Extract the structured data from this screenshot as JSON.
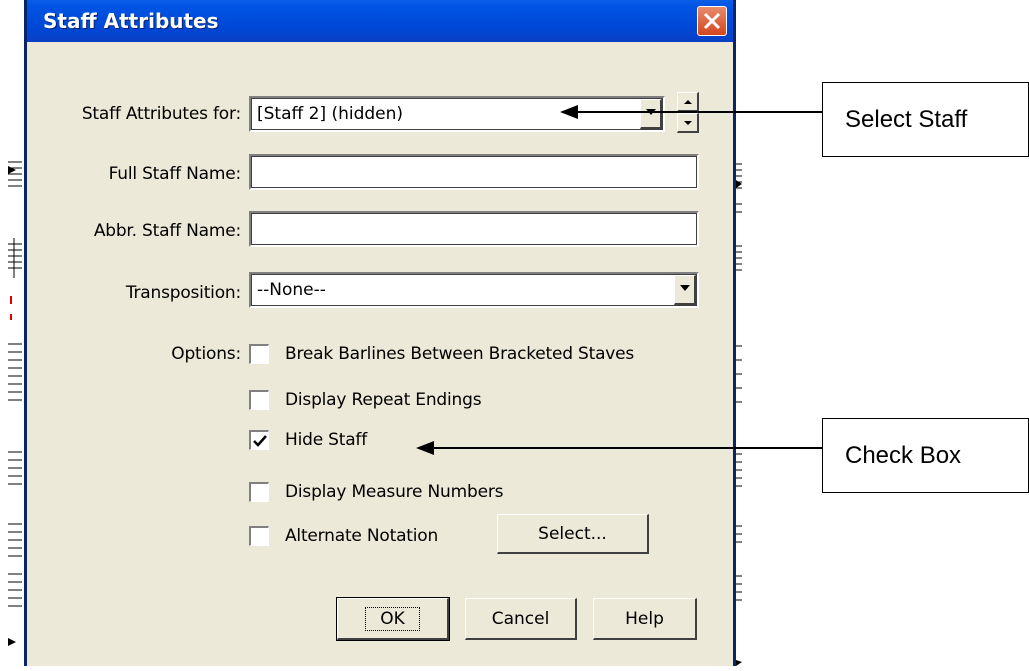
{
  "dialog": {
    "title": "Staff Attributes",
    "staff_for_label": "Staff Attributes for:",
    "staff_for_value": "[Staff 2] (hidden)",
    "full_name_label": "Full Staff Name:",
    "full_name_value": "",
    "abbr_name_label": "Abbr. Staff Name:",
    "abbr_name_value": "",
    "transposition_label": "Transposition:",
    "transposition_value": "--None--",
    "options_label": "Options:",
    "options": [
      {
        "label": "Break Barlines Between Bracketed Staves",
        "checked": false
      },
      {
        "label": "Display Repeat Endings",
        "checked": false
      },
      {
        "label": "Hide Staff",
        "checked": true
      },
      {
        "label": "Display Measure Numbers",
        "checked": false
      },
      {
        "label": "Alternate Notation",
        "checked": false
      }
    ],
    "select_button": "Select...",
    "ok_button": "OK",
    "cancel_button": "Cancel",
    "help_button": "Help"
  },
  "callouts": {
    "select_staff": "Select Staff",
    "check_box": "Check Box"
  },
  "colors": {
    "titlebar": "#0054e3",
    "dialog_bg": "#ece9d8",
    "close_button": "#d2461f"
  }
}
